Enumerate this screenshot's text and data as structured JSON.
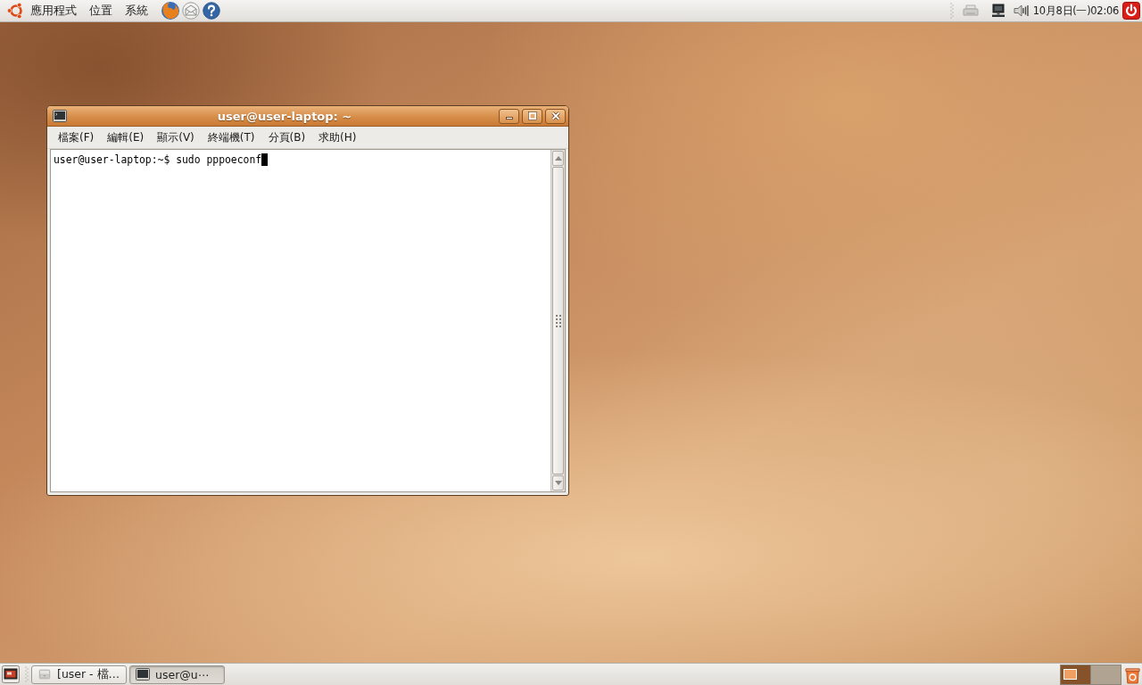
{
  "top_panel": {
    "menus": [
      "應用程式",
      "位置",
      "系統"
    ],
    "clock": "10月8日(一)02:06"
  },
  "window": {
    "title": "user@user-laptop: ~",
    "menu": [
      "檔案(F)",
      "編輯(E)",
      "顯示(V)",
      "終端機(T)",
      "分頁(B)",
      "求助(H)"
    ],
    "lines": [
      "user@user-laptop:~$ sudo pppoeconf"
    ]
  },
  "taskbar": {
    "tasks": [
      {
        "label": "[user - 檔…",
        "kind": "files",
        "selected": false
      },
      {
        "label": "user@u⋯",
        "kind": "terminal",
        "selected": true
      }
    ],
    "workspaces": [
      {
        "selected": true,
        "has_window": true
      },
      {
        "selected": false,
        "has_window": false
      }
    ]
  }
}
